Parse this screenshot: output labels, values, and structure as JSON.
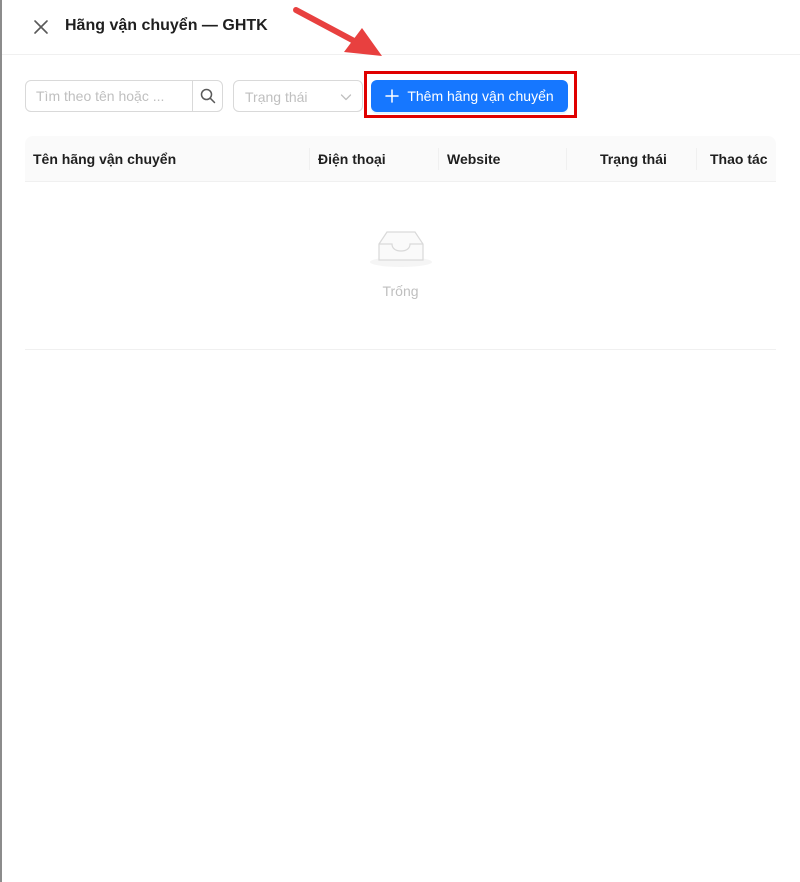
{
  "header": {
    "title": "Hãng vận chuyển — GHTK"
  },
  "toolbar": {
    "search_placeholder": "Tìm theo tên hoặc ...",
    "status_placeholder": "Trạng thái",
    "add_button_label": "Thêm hãng vận chuyển"
  },
  "table": {
    "columns": [
      "Tên hãng vận chuyển",
      "Điện thoại",
      "Website",
      "Trạng thái",
      "Thao tác"
    ],
    "rows": [],
    "empty_text": "Trống"
  },
  "colors": {
    "primary": "#1677ff",
    "highlight": "#e00000",
    "arrow": "#e8403f"
  },
  "icons": {
    "close": "close-icon",
    "search": "search-icon",
    "dropdown": "chevron-down-icon",
    "add": "plus-icon",
    "empty": "empty-inbox-icon",
    "annotation": "arrow-annotation"
  }
}
